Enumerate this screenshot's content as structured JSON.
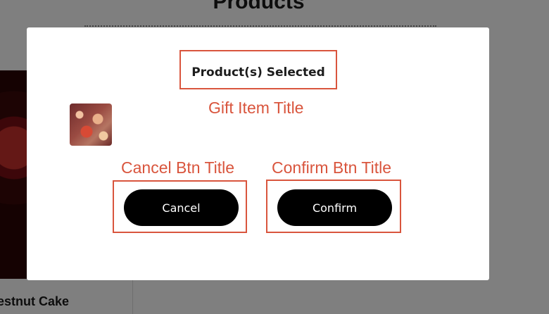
{
  "background": {
    "page_title": "Products",
    "card_title": "estnut Cake"
  },
  "modal": {
    "heading": "Product(s) Selected",
    "annotations": {
      "gift_item_title": "Gift Item Title",
      "cancel_btn_title": "Cancel Btn Title",
      "confirm_btn_title": "Confirm Btn Title"
    },
    "buttons": {
      "cancel": "Cancel",
      "confirm": "Confirm"
    }
  },
  "colors": {
    "annotation": "#d9553d",
    "button_bg": "#000000",
    "button_text": "#ffffff",
    "overlay": "rgba(0,0,0,0.5)"
  }
}
